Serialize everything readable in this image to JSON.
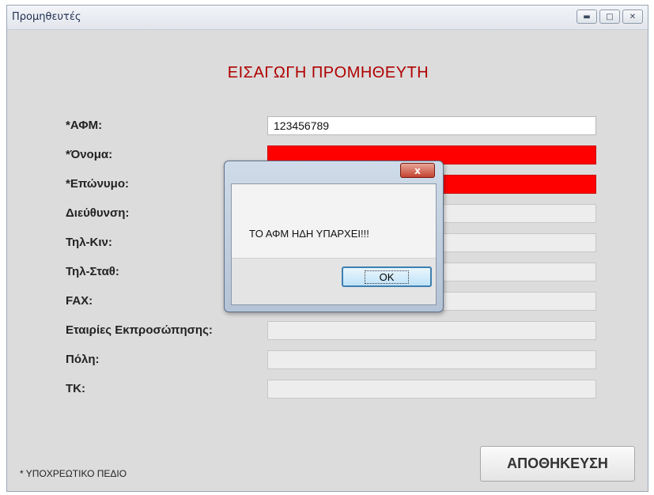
{
  "window": {
    "title": "Προμηθευτές",
    "min_icon": "minimize-icon",
    "max_icon": "maximize-icon",
    "close_icon": "close-icon"
  },
  "form": {
    "heading": "ΕΙΣΑΓΩΓΗ ΠΡΟΜΗΘΕΥΤΗ",
    "fields": [
      {
        "label": "*ΑΦΜ:",
        "value": "123456789"
      },
      {
        "label": "*Όνομα:",
        "value": ""
      },
      {
        "label": "*Επώνυμο:",
        "value": ""
      },
      {
        "label": "Διεύθυνση:",
        "value": ""
      },
      {
        "label": "Τηλ-Κιν:",
        "value": ""
      },
      {
        "label": "Τηλ-Σταθ:",
        "value": ""
      },
      {
        "label": "FAX:",
        "value": ""
      },
      {
        "label": "Εταιρίες Εκπροσώπησης:",
        "value": ""
      },
      {
        "label": "Πόλη:",
        "value": ""
      },
      {
        "label": "ΤΚ:",
        "value": ""
      }
    ],
    "footnote": "* ΥΠΟΧΡΕΩΤΙΚΟ ΠΕΔΙΟ",
    "save_label": "ΑΠΟΘΗΚΕΥΣΗ"
  },
  "dialog": {
    "message": "ΤΟ ΑΦΜ ΗΔΗ ΥΠΑΡΧΕΙ!!!",
    "ok_label": "OK",
    "close_glyph": "x"
  },
  "colors": {
    "heading": "#b00000",
    "required_error": "#ff0000"
  }
}
